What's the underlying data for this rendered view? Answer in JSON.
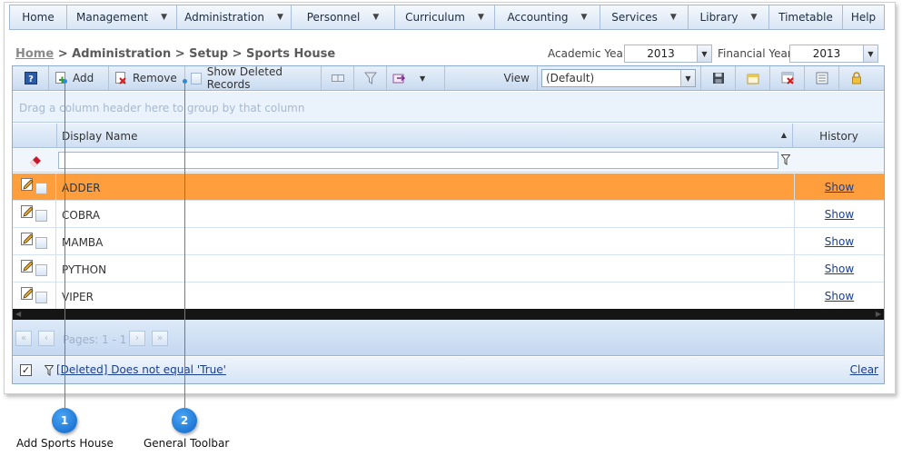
{
  "menu": [
    {
      "label": "Home",
      "has_dropdown": false
    },
    {
      "label": "Management",
      "has_dropdown": true
    },
    {
      "label": "Administration",
      "has_dropdown": true
    },
    {
      "label": "Personnel",
      "has_dropdown": true
    },
    {
      "label": "Curriculum",
      "has_dropdown": true
    },
    {
      "label": "Accounting",
      "has_dropdown": true
    },
    {
      "label": "Services",
      "has_dropdown": true
    },
    {
      "label": "Library",
      "has_dropdown": true
    },
    {
      "label": "Timetable",
      "has_dropdown": false
    },
    {
      "label": "Help",
      "has_dropdown": false
    }
  ],
  "breadcrumb": {
    "home": "Home",
    "rest": " > Administration > Setup > Sports House"
  },
  "academic_year": {
    "label": "Academic Year",
    "value": "2013"
  },
  "financial_year": {
    "label": "Financial Year",
    "value": "2013"
  },
  "toolbar": {
    "add_label": "Add",
    "remove_label": "Remove",
    "show_deleted_label": "Show Deleted Records",
    "view_label": "View",
    "view_value": "(Default)"
  },
  "grid": {
    "group_hint": "Drag a column header here to group by that column",
    "columns": {
      "display_name": "Display Name",
      "history": "History"
    },
    "rows": [
      {
        "name": "ADDER",
        "history": "Show",
        "selected": true
      },
      {
        "name": "COBRA",
        "history": "Show",
        "selected": false
      },
      {
        "name": "MAMBA",
        "history": "Show",
        "selected": false
      },
      {
        "name": "PYTHON",
        "history": "Show",
        "selected": false
      },
      {
        "name": "VIPER",
        "history": "Show",
        "selected": false
      }
    ],
    "pager_label": "Pages: 1 - 1",
    "filter_expression": "[Deleted] Does not equal 'True'",
    "clear_label": "Clear"
  },
  "callouts": [
    {
      "number": "1",
      "caption": "Add Sports House"
    },
    {
      "number": "2",
      "caption": "General Toolbar"
    }
  ],
  "colors": {
    "selected_row": "#fe9e3c",
    "callout": "#2f8ad7",
    "link": "#1a3f8f"
  }
}
